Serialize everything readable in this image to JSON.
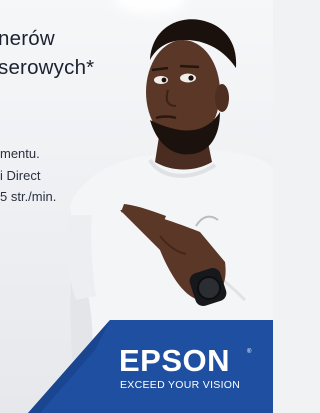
{
  "headline": {
    "line1": "nerów",
    "line2": "serowych*"
  },
  "features": [
    "mentu.",
    "i Direct",
    "5 str./min."
  ],
  "brand": {
    "logo": "EPSON",
    "registered": "®",
    "tagline": "EXCEED YOUR VISION",
    "color": "#1f4fa1"
  }
}
